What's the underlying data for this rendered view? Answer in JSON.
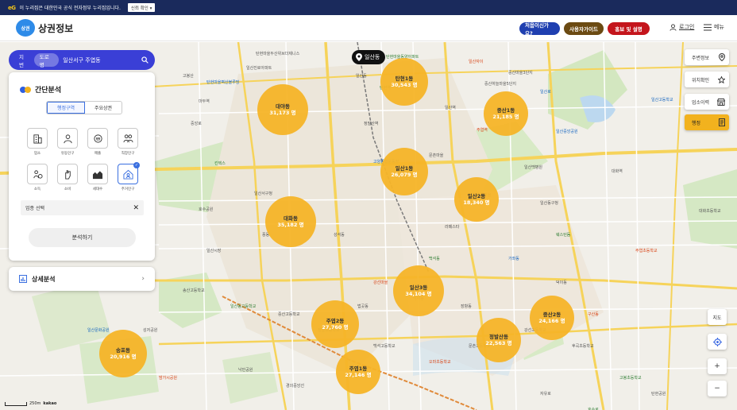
{
  "gov_banner": {
    "logo": "eG",
    "text": "이 누리집은 대한민국 공식 전자정부 누리집입니다.",
    "select": "신뢰 확인 ▾"
  },
  "header": {
    "logo_badge": "상권",
    "logo_text": "상권정보",
    "btn_first": "처음이신가요?",
    "btn_guide": "사용자가이드",
    "btn_promo": "홍보 및 설명",
    "login": "로그인",
    "menu": "메뉴"
  },
  "search": {
    "tab_map": "지번",
    "tab_road": "도로명",
    "value": "일산서구 주엽동"
  },
  "location_pin": "일산동",
  "panel": {
    "title": "간단분석",
    "seg_admin": "행정구역",
    "seg_main": "주요상권",
    "icons": [
      {
        "label": "업소",
        "icon": "building-icon"
      },
      {
        "label": "유동인구",
        "icon": "person-icon"
      },
      {
        "label": "매출",
        "icon": "coin-icon"
      },
      {
        "label": "직장인구",
        "icon": "workers-icon"
      },
      {
        "label": "소득",
        "icon": "income-icon"
      },
      {
        "label": "소비",
        "icon": "hand-icon"
      },
      {
        "label": "세대수",
        "icon": "houses-icon"
      },
      {
        "label": "주거인구",
        "icon": "residence-icon"
      }
    ],
    "biz_select": "업종 선택",
    "analyze": "분석하기"
  },
  "detail": {
    "label": "상세분석"
  },
  "right_controls": [
    {
      "label": "주변정보",
      "icon": "pin-icon"
    },
    {
      "label": "위치확인",
      "icon": "star-icon"
    },
    {
      "label": "업소이력",
      "icon": "store-icon"
    },
    {
      "label": "행정",
      "icon": "doc-icon"
    }
  ],
  "map_controls": {
    "satellite": "지도",
    "zoom_in": "+",
    "zoom_out": "−"
  },
  "scale": {
    "label": "250m",
    "brand": "kakao"
  },
  "bubbles": [
    {
      "name": "대야동",
      "pop": "31,173 명"
    },
    {
      "name": "탄현1동",
      "pop": "30,543 명"
    },
    {
      "name": "중산1동",
      "pop": "21,185 명"
    },
    {
      "name": "일산1동",
      "pop": "26,079 명"
    },
    {
      "name": "일산2동",
      "pop": "18,340 명"
    },
    {
      "name": "대화동",
      "pop": "35,182 명"
    },
    {
      "name": "일산3동",
      "pop": "34,104 명"
    },
    {
      "name": "주엽2동",
      "pop": "27,760 명"
    },
    {
      "name": "정발산동",
      "pop": "22,563 명"
    },
    {
      "name": "중산2동",
      "pop": "24,166 명"
    },
    {
      "name": "송포동",
      "pop": "20,916 명"
    },
    {
      "name": "주엽1동",
      "pop": "27,146 명"
    }
  ],
  "labels": [
    "탄현마을두산위브더제니스",
    "탄현마을동양아파트",
    "일산진로아파트",
    "탄현마을벽산블루밍",
    "일산동",
    "일산자이",
    "중산하늘마을5단지",
    "중산마을3단지",
    "고봉산",
    "탄현역",
    "일산역",
    "일산중앙공원",
    "대화역",
    "주엽역",
    "정발산역",
    "마두역",
    "일산서구청",
    "킨텍스",
    "호수공원",
    "고양종합운동장",
    "문촌마을",
    "강선마을",
    "후곡마을",
    "일산백병원",
    "일산동구청",
    "웨스턴돔",
    "라페스타",
    "일산고등학교",
    "대화초등학교",
    "주엽초등학교",
    "일산시장",
    "풍동",
    "성석동",
    "백석동",
    "장항동",
    "가좌동",
    "덕이동",
    "구산동",
    "법곳동",
    "식사동",
    "송산고등학교",
    "일산동고등학교",
    "중산고등학교",
    "정발고등학교",
    "백석고등학교",
    "오마초등학교",
    "문촌초등학교",
    "강선초등학교",
    "후곡초등학교",
    "고봉초등학교",
    "탄현공원",
    "일산문화공원",
    "성저공원",
    "밤가시공원",
    "낙민공원",
    "경의중앙선",
    "자유로",
    "호수로",
    "중앙로",
    "일산로"
  ]
}
